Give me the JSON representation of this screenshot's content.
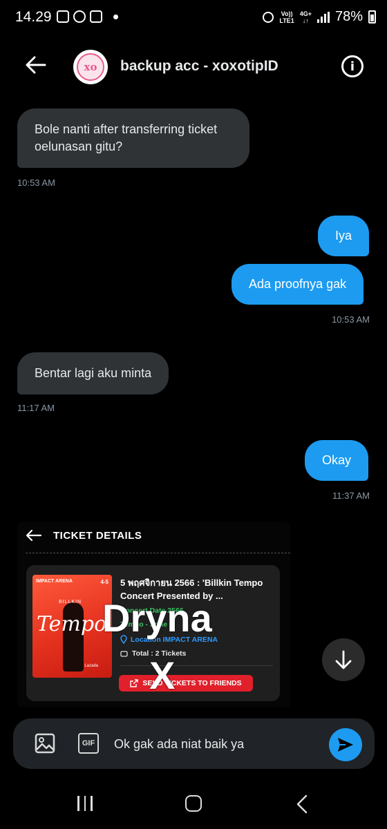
{
  "status_bar": {
    "time": "14.29",
    "network_top": "Vo))",
    "network_bottom": "LTE1",
    "network_type_top": "4G+",
    "network_type_bottom": "↓↑",
    "battery": "78%"
  },
  "header": {
    "avatar_initials": "xo",
    "title": "backup acc - xoxotipID"
  },
  "messages": [
    {
      "direction": "in",
      "text": "Bole nanti after transferring ticket oelunasan gitu?",
      "time": "10:53 AM"
    },
    {
      "direction": "out",
      "text": "Iya",
      "time": ""
    },
    {
      "direction": "out",
      "text": "Ada proofnya gak",
      "time": "10:53 AM"
    },
    {
      "direction": "in",
      "text": "Bentar lagi aku minta",
      "time": "11:17 AM"
    },
    {
      "direction": "out",
      "text": "Okay",
      "time": "11:37 AM"
    }
  ],
  "ticket": {
    "heading": "TICKET DETAILS",
    "poster": {
      "venue": "IMPACT ARENA",
      "date": "4-5",
      "artist": "BILLKIN",
      "title": "Tempo",
      "brand": "Lazada"
    },
    "event_title": "5 พฤศจิกายน 2566 : 'Billkin Tempo Concert Presented by ...",
    "line_green_1": "Concert Date 2566",
    "line_green_2": "Tempo - Zone",
    "location": "Location IMPACT ARENA",
    "total": "Total : 2 Tickets",
    "send_button": "SEND TICKETS TO FRIENDS"
  },
  "watermark": {
    "line1": "Dryna",
    "line2": "X"
  },
  "composer": {
    "gif_label": "GIF",
    "value": "Ok gak ada niat baik ya"
  },
  "colors": {
    "background": "#000000",
    "incoming_bubble": "#2f3336",
    "outgoing_bubble": "#1d9bf0",
    "timestamp": "#8b98a5",
    "composer_bg": "#202327",
    "ticket_button": "#e0202b"
  }
}
